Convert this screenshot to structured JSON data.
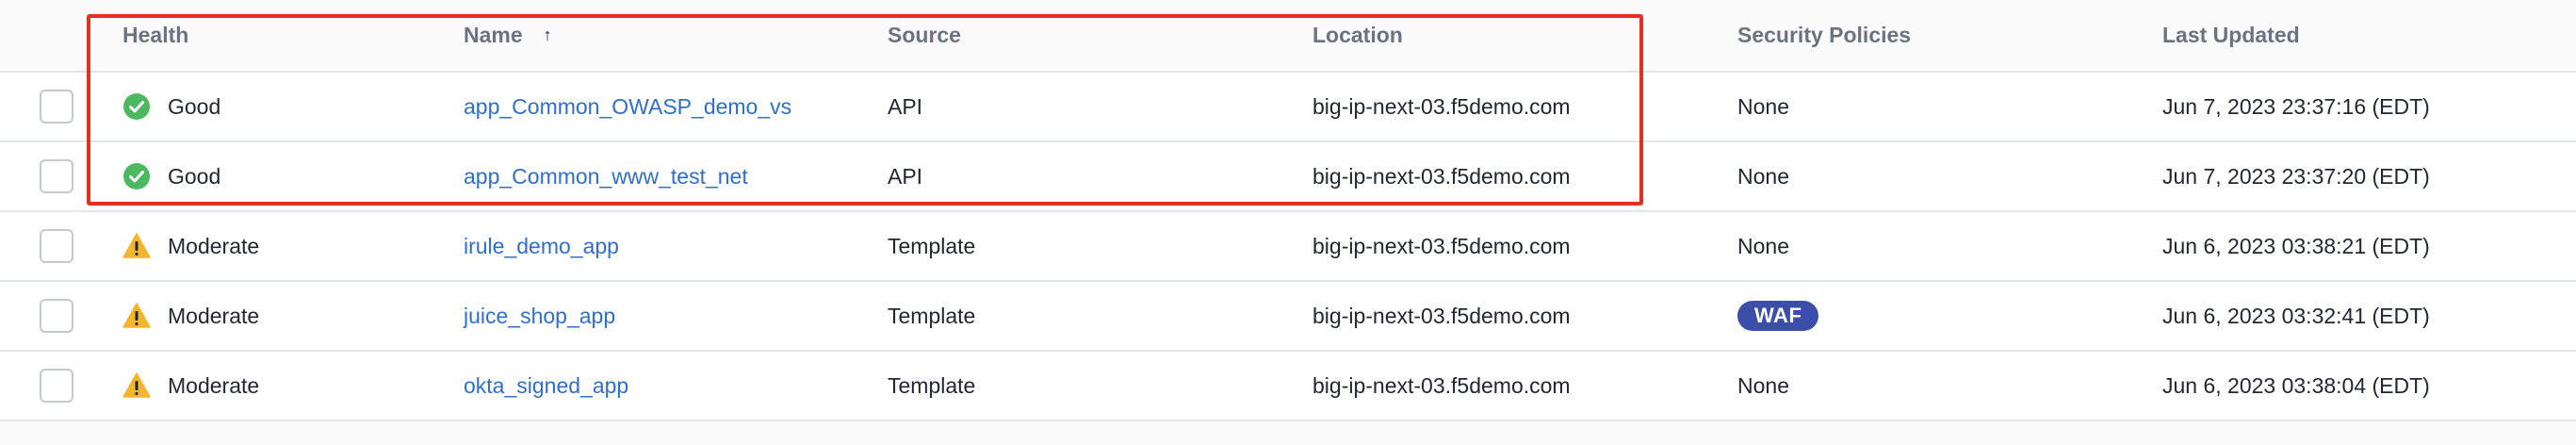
{
  "table": {
    "columns": {
      "health": "Health",
      "name": "Name",
      "source": "Source",
      "location": "Location",
      "security": "Security Policies",
      "updated": "Last Updated"
    },
    "sort_indicator": "↑",
    "rows": [
      {
        "health": "Good",
        "health_icon": "check-circle-icon",
        "name": "app_Common_OWASP_demo_vs",
        "source": "API",
        "location": "big-ip-next-03.f5demo.com",
        "security": "None",
        "updated": "Jun 7, 2023 23:37:16 (EDT)"
      },
      {
        "health": "Good",
        "health_icon": "check-circle-icon",
        "name": "app_Common_www_test_net",
        "source": "API",
        "location": "big-ip-next-03.f5demo.com",
        "security": "None",
        "updated": "Jun 7, 2023 23:37:20 (EDT)"
      },
      {
        "health": "Moderate",
        "health_icon": "warning-triangle-icon",
        "name": "irule_demo_app",
        "source": "Template",
        "location": "big-ip-next-03.f5demo.com",
        "security": "None",
        "updated": "Jun 6, 2023 03:38:21 (EDT)"
      },
      {
        "health": "Moderate",
        "health_icon": "warning-triangle-icon",
        "name": "juice_shop_app",
        "source": "Template",
        "location": "big-ip-next-03.f5demo.com",
        "security": "WAF",
        "updated": "Jun 6, 2023 03:32:41 (EDT)"
      },
      {
        "health": "Moderate",
        "health_icon": "warning-triangle-icon",
        "name": "okta_signed_app",
        "source": "Template",
        "location": "big-ip-next-03.f5demo.com",
        "security": "None",
        "updated": "Jun 6, 2023 03:38:04 (EDT)"
      }
    ]
  },
  "colors": {
    "good": "#4cb960",
    "moderate": "#f3b52b",
    "link": "#2f6fcb",
    "waf_badge": "#3b4ea9",
    "highlight": "#e2321f"
  }
}
